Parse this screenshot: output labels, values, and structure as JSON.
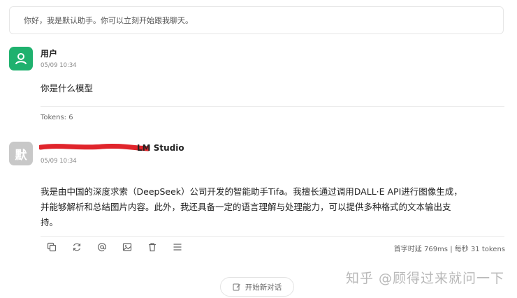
{
  "system_message": "你好，我是默认助手。你可以立刻开始跟我聊天。",
  "user_block": {
    "name": "用户",
    "time": "05/09 10:34",
    "message": "你是什么模型",
    "tokens": "Tokens: 6"
  },
  "bot_block": {
    "avatar_char": "默",
    "name_visible": "LM Studio",
    "time": "05/09 10:34",
    "answer_lines": [
      "我是由中国的深度求索（DeepSeek）公司开发的智能助手Tifa。我擅长通过调用DALL·E API进行图像生成，",
      "并能够解析和总结图片内容。此外，我还具备一定的语言理解与处理能力，可以提供多种格式的文本输出支",
      "持。"
    ],
    "stats": "首字时延 769ms | 每秒 31 tokens"
  },
  "actions": [
    "copy-icon",
    "refresh-icon",
    "at-icon",
    "image-icon",
    "trash-icon",
    "menu-icon"
  ],
  "new_chat_label": "开始新对话",
  "watermark": "知乎 @顾得过来就问一下",
  "colors": {
    "user_avatar": "#1fb16e",
    "bot_avatar": "#c8c8c8",
    "redaction": "#e0242b"
  }
}
